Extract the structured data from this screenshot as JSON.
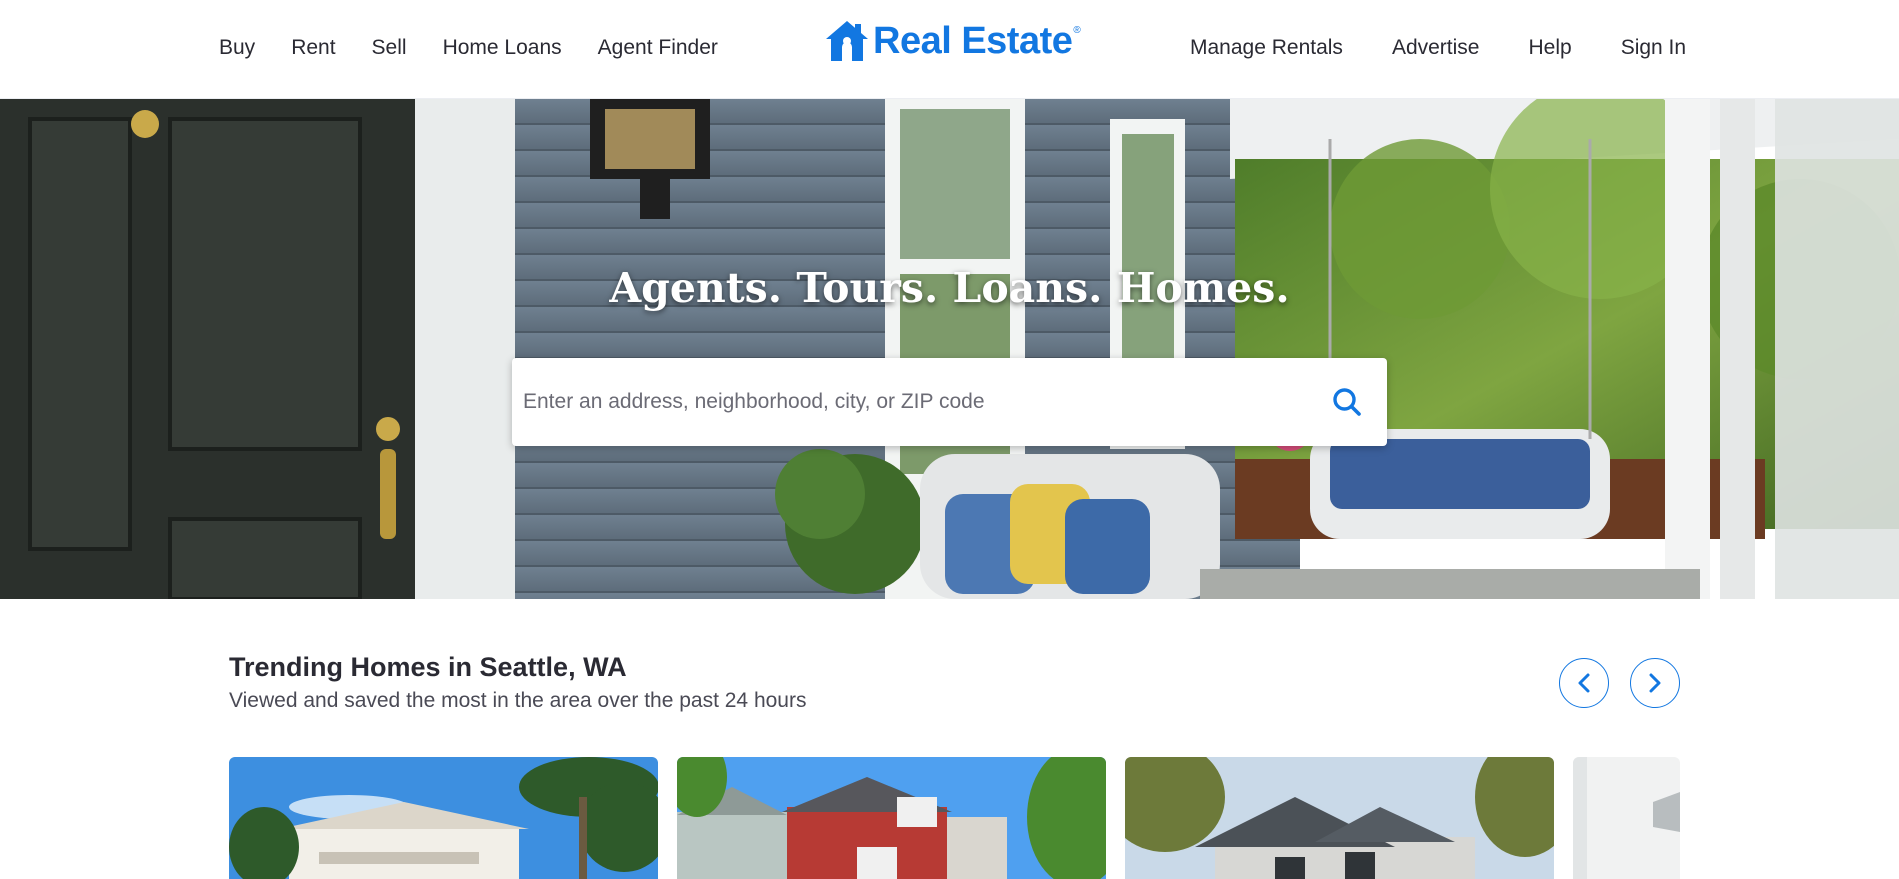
{
  "header": {
    "nav_left": [
      "Buy",
      "Rent",
      "Sell",
      "Home Loans",
      "Agent Finder"
    ],
    "nav_right": [
      "Manage Rentals",
      "Advertise",
      "Help",
      "Sign In"
    ],
    "logo_text": "Real Estate",
    "logo_mark": "®",
    "logo_icon": "house-icon"
  },
  "hero": {
    "title": "Agents. Tours. Loans. Homes.",
    "search_placeholder": "Enter an address, neighborhood, city, or ZIP code",
    "search_icon": "search-icon"
  },
  "trending": {
    "title": "Trending Homes in Seattle, WA",
    "subtitle": "Viewed and saved the most in the area over the past 24 hours",
    "prev_icon": "chevron-left-icon",
    "next_icon": "chevron-right-icon",
    "cards": [
      {
        "image": "home-photo-palm-trees"
      },
      {
        "image": "home-photo-red-house"
      },
      {
        "image": "home-photo-gray-house"
      },
      {
        "image": "home-photo-partial"
      }
    ]
  },
  "colors": {
    "brand": "#1277e1",
    "text": "#2a2a33"
  }
}
